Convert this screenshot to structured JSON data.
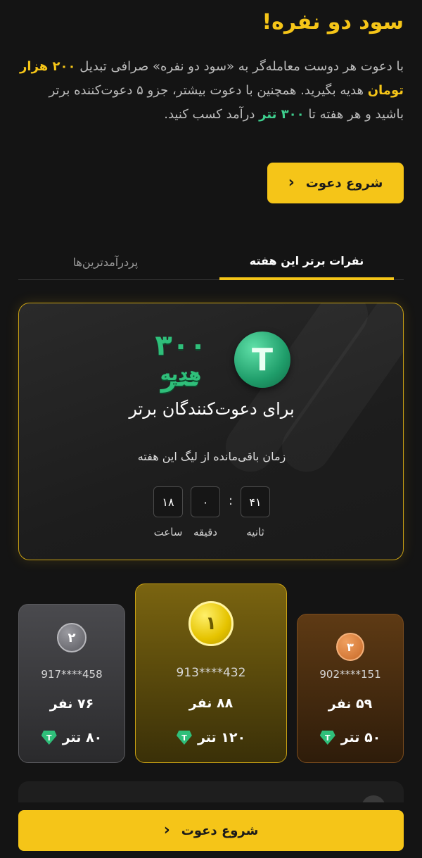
{
  "header": {
    "title": "سود دو نفره!",
    "description_part1": "با دعوت هر دوست معامله‌گر به «سود دو نفره» صرافی تبدیل ",
    "description_highlight1": "۲۰۰ هزار تومان",
    "description_part2": " هدیه بگیرید. همچنین با دعوت بیشتر، جزو ۵ دعوت‌کننده برتر باشید و هر هفته تا ",
    "description_highlight2": "۳۰۰ تتر",
    "description_part3": " درآمد کسب کنید."
  },
  "cta": {
    "label": "شروع دعوت",
    "icon": "chevron-left-icon"
  },
  "tabs": [
    {
      "label": "نفرات برتر این هفته",
      "active": true
    },
    {
      "label": "پردرآمدترین‌ها",
      "active": false
    }
  ],
  "hero": {
    "prize_amount": "۳۰۰ تتر",
    "prize_word": "هدیه",
    "coin_symbol": "T",
    "caption": "برای دعوت‌کنندگان برتر",
    "countdown_label": "زمان باقی‌مانده از لیگ این هفته",
    "seconds": "۴۱",
    "minutes": "۰",
    "hours": "۱۸",
    "separator": ":",
    "seconds_label": "ثانیه",
    "minutes_label": "دقیقه",
    "hours_label": "ساعت"
  },
  "leaders": [
    {
      "rank": "۱",
      "phone": "913****432",
      "count": "۸۸ نفر",
      "reward": "۱۲۰ تتر"
    },
    {
      "rank": "۲",
      "phone": "917****458",
      "count": "۷۶ نفر",
      "reward": "۸۰ تتر"
    },
    {
      "rank": "۳",
      "phone": "902****151",
      "count": "۵۹ نفر",
      "reward": "۵۰ تتر"
    }
  ],
  "colors": {
    "accent": "#f5c518",
    "green": "#2fbf7a",
    "background": "#141414",
    "gold_card": "#7a6410",
    "silver_card": "#4a4a4e",
    "bronze_card": "#5e3a14"
  }
}
